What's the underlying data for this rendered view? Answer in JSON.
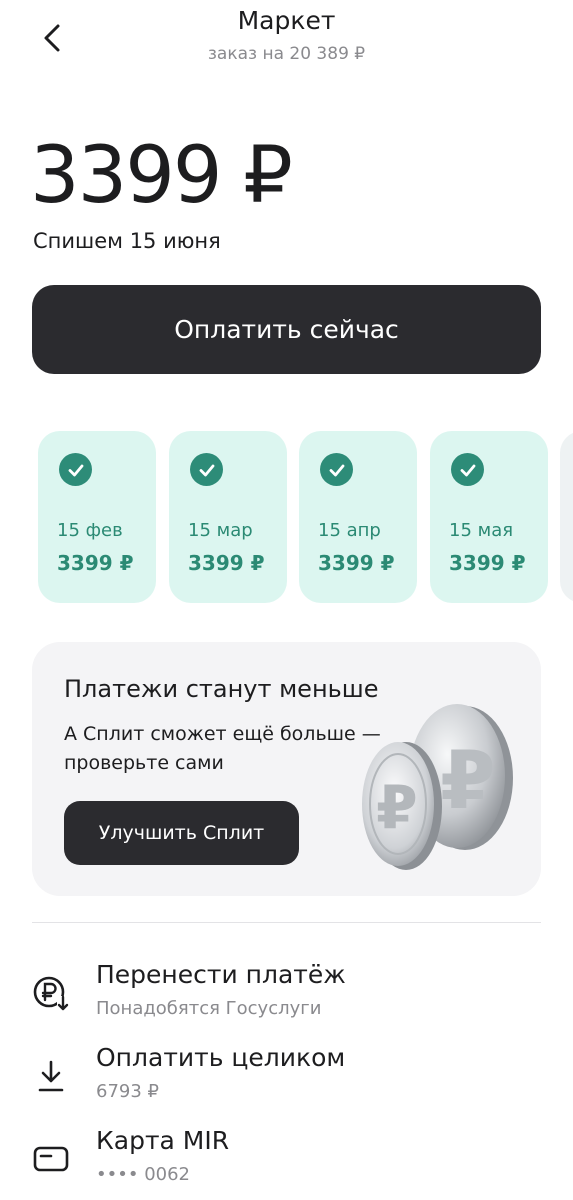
{
  "header": {
    "back_icon": "chevron-left-icon",
    "title": "Маркет",
    "subtitle": "заказ на 20 389 ₽"
  },
  "summary": {
    "amount": "3399 ₽",
    "due": "Спишем 15 июня"
  },
  "pay_now_label": "Оплатить сейчас",
  "schedule": [
    {
      "date": "15 фев",
      "amount": "3399 ₽",
      "paid": true
    },
    {
      "date": "15 мар",
      "amount": "3399 ₽",
      "paid": true
    },
    {
      "date": "15 апр",
      "amount": "3399 ₽",
      "paid": true
    },
    {
      "date": "15 мая",
      "amount": "3399 ₽",
      "paid": true
    }
  ],
  "promo": {
    "title": "Платежи станут меньше",
    "text": "А Сплит сможет ещё больше — проверьте сами",
    "button": "Улучшить Сплит",
    "image": "ruble-coins-illustration"
  },
  "actions": [
    {
      "icon": "ruble-transfer-icon",
      "title": "Перенести платёж",
      "subtitle": "Понадобятся Госуслуги"
    },
    {
      "icon": "download-icon",
      "title": "Оплатить целиком",
      "subtitle": "6793 ₽"
    },
    {
      "icon": "card-icon",
      "title": "Карта MIR",
      "subtitle": "•••• 0062"
    }
  ],
  "colors": {
    "accent_dark": "#2b2b2f",
    "paid_bg": "#dcf6f0",
    "paid_text": "#2b8a74",
    "promo_bg": "#f4f4f6"
  }
}
